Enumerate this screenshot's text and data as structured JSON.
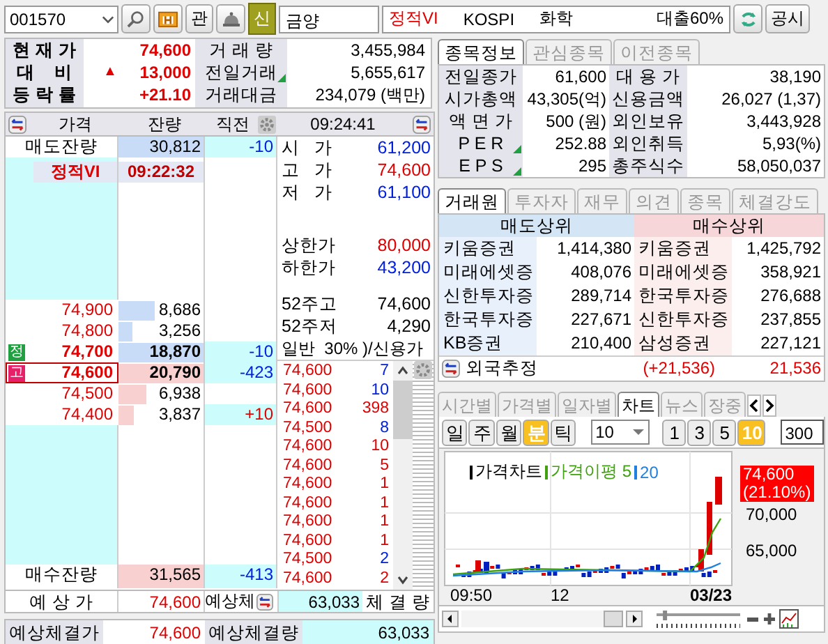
{
  "top_bar": {
    "code": "001570",
    "watch_button": "관",
    "badge": "신",
    "name": "금양",
    "status": "정적VI",
    "market": "KOSPI",
    "sector": "화학",
    "loan": "대출60%",
    "disclosure_button": "공시"
  },
  "summary": {
    "left": [
      {
        "label": "현 재 가",
        "value": "74,600"
      },
      {
        "label": "대    비",
        "value": "13,000",
        "arrow": "▲"
      },
      {
        "label": "등 락 률",
        "value": "+21.10"
      }
    ],
    "right": [
      {
        "label": "거 래 량",
        "value": "3,455,984",
        "note": false
      },
      {
        "label": "전일거래",
        "value": "5,655,617",
        "note": true
      },
      {
        "label": "거래대금",
        "value": "234,079 (백만)",
        "note": false
      }
    ]
  },
  "order_book": {
    "columns": [
      "가격",
      "잔량",
      "직전"
    ],
    "time": "09:24:41",
    "ask_total": {
      "label": "매도잔량",
      "volume": "30,812",
      "change": "-10",
      "color": "#0020e0"
    },
    "vi": {
      "label": "정적VI",
      "time": "09:22:32"
    },
    "levels": [
      {
        "kind": "ask",
        "price": "74,900",
        "volume": "8,686",
        "level": 0.42,
        "selected": false
      },
      {
        "kind": "ask",
        "price": "74,800",
        "volume": "3,256",
        "level": 0.16,
        "selected": false
      },
      {
        "kind": "ask",
        "price": "74,700",
        "volume": "18,870",
        "level": 1,
        "change": "-10",
        "color": "#0020e0",
        "tag": {
          "text": "정",
          "color": "#20a040"
        },
        "selected": false
      },
      {
        "kind": "bid",
        "price": "74,600",
        "volume": "20,790",
        "level": 1,
        "change": "-423",
        "color": "#0020e0",
        "tag": {
          "text": "고",
          "color": "#e8206a"
        },
        "selected": true
      },
      {
        "kind": "bid",
        "price": "74,500",
        "volume": "6,938",
        "level": 0.33,
        "selected": false
      },
      {
        "kind": "bid",
        "price": "74,400",
        "volume": "3,837",
        "level": 0.18,
        "change": "+10",
        "color": "#e00000",
        "selected": false
      }
    ],
    "bid_total": {
      "label": "매수잔량",
      "volume": "31,565",
      "change": "-413",
      "color": "#0020e0"
    },
    "expected": {
      "label": "예 상 가",
      "price": "74,600",
      "label2": "예상체",
      "volume": "63,033",
      "label3": "체 결 량"
    }
  },
  "market_info": [
    [
      {
        "label": "시   가",
        "value": "61,200",
        "color": "#0020e0"
      },
      {
        "label": "고   가",
        "value": "74,600",
        "color": "#e00000"
      },
      {
        "label": "저   가",
        "value": "61,100",
        "color": "#0020e0"
      }
    ],
    [
      {
        "label": "상한가",
        "value": "80,000",
        "color": "#e00000"
      },
      {
        "label": "하한가",
        "value": "43,200",
        "color": "#0020e0"
      }
    ],
    [
      {
        "label": "52주고",
        "value": "74,600",
        "color": "#000000"
      },
      {
        "label": "52주저",
        "value": "4,290",
        "color": "#000000"
      }
    ]
  ],
  "credit_label": "일반  30% )/신용가",
  "ticks": [
    {
      "price": "74,600",
      "volume": "7",
      "color": "#0020e0"
    },
    {
      "price": "74,600",
      "volume": "10",
      "color": "#0020e0"
    },
    {
      "price": "74,600",
      "volume": "398",
      "color": "#e00000"
    },
    {
      "price": "74,500",
      "volume": "8",
      "color": "#0020e0"
    },
    {
      "price": "74,600",
      "volume": "10",
      "color": "#e00000"
    },
    {
      "price": "74,600",
      "volume": "5",
      "color": "#e00000"
    },
    {
      "price": "74,600",
      "volume": "1",
      "color": "#e00000"
    },
    {
      "price": "74,600",
      "volume": "1",
      "color": "#e00000"
    },
    {
      "price": "74,600",
      "volume": "1",
      "color": "#e00000"
    },
    {
      "price": "74,600",
      "volume": "1",
      "color": "#e00000"
    },
    {
      "price": "74,500",
      "volume": "2",
      "color": "#0020e0"
    },
    {
      "price": "74,600",
      "volume": "2",
      "color": "#e00000"
    }
  ],
  "footer": {
    "label": "예상체결가",
    "price": "74,600",
    "label2": "예상체결량",
    "volume": "63,033"
  },
  "info_tabs": [
    {
      "label": "종목정보",
      "selected": true
    },
    {
      "label": "관심종목",
      "selected": false
    },
    {
      "label": "이전종목",
      "selected": false
    }
  ],
  "stock_info": [
    {
      "label": "전일종가",
      "value": "61,600",
      "label2": "대 용 가",
      "value2": "38,190",
      "note": false
    },
    {
      "label": "시가총액",
      "value": "43,305(억)",
      "label2": "신용금액",
      "value2": "26,027 (1,37)",
      "note": false
    },
    {
      "label": "액 면 가",
      "value": "500 (원)",
      "label2": "외인보유",
      "value2": "3,443,928",
      "note": false
    },
    {
      "label": "P E R",
      "value": "252.88",
      "label2": "외인취득",
      "value2": "5,93(%)",
      "note": true
    },
    {
      "label": "E P S",
      "value": "295",
      "label2": "총주식수",
      "value2": "58,050,037",
      "note": true
    }
  ],
  "broker_tabs": [
    {
      "label": "거래원",
      "selected": true
    },
    {
      "label": "투자자",
      "selected": false
    },
    {
      "label": "재무",
      "selected": false
    },
    {
      "label": "의견",
      "selected": false
    },
    {
      "label": "종목",
      "selected": false
    },
    {
      "label": "체결강도",
      "selected": false
    }
  ],
  "brokers": {
    "sell_header": "매도상위",
    "buy_header": "매수상위",
    "rows": [
      {
        "sell_name": "키움증권",
        "sell_volume": "1,414,380",
        "buy_name": "키움증권",
        "buy_volume": "1,425,792"
      },
      {
        "sell_name": "미래에셋증",
        "sell_volume": "408,076",
        "buy_name": "미래에셋증",
        "buy_volume": "358,921"
      },
      {
        "sell_name": "신한투자증",
        "sell_volume": "289,714",
        "buy_name": "한국투자증",
        "buy_volume": "276,688"
      },
      {
        "sell_name": "한국투자증",
        "sell_volume": "227,671",
        "buy_name": "신한투자증",
        "buy_volume": "237,855"
      },
      {
        "sell_name": "KB증권",
        "sell_volume": "210,400",
        "buy_name": "삼성증권",
        "buy_volume": "227,121"
      }
    ],
    "foreign": {
      "label": "외국추정",
      "net": "(+21,536)",
      "volume": "21,536"
    }
  },
  "chart_tabs": [
    {
      "label": "시간별",
      "selected": false
    },
    {
      "label": "가격별",
      "selected": false
    },
    {
      "label": "일자별",
      "selected": false
    },
    {
      "label": "차트",
      "selected": true
    },
    {
      "label": "뉴스",
      "selected": false
    },
    {
      "label": "장중",
      "selected": false
    }
  ],
  "periods": [
    {
      "label": "일",
      "selected": false
    },
    {
      "label": "주",
      "selected": false
    },
    {
      "label": "월",
      "selected": false
    },
    {
      "label": "분",
      "selected": true
    },
    {
      "label": "틱",
      "selected": false
    }
  ],
  "interval_select": "10",
  "intervals": [
    {
      "label": "1",
      "selected": false
    },
    {
      "label": "3",
      "selected": false
    },
    {
      "label": "5",
      "selected": false
    },
    {
      "label": "10",
      "selected": true
    }
  ],
  "count_field": "300",
  "chart": {
    "legend": [
      {
        "label": "가격차트",
        "color": "#000000"
      },
      {
        "label": "가격이평 5",
        "color": "#40a010"
      },
      {
        "label": "20",
        "color": "#2080e0"
      }
    ],
    "price_tag": [
      "74,600",
      "(21.10%)"
    ],
    "y_labels": [
      "70,000",
      "65,000"
    ],
    "x_labels": [
      "09:50",
      "12",
      "03/23"
    ]
  },
  "zoom": {
    "level": 0.08
  }
}
